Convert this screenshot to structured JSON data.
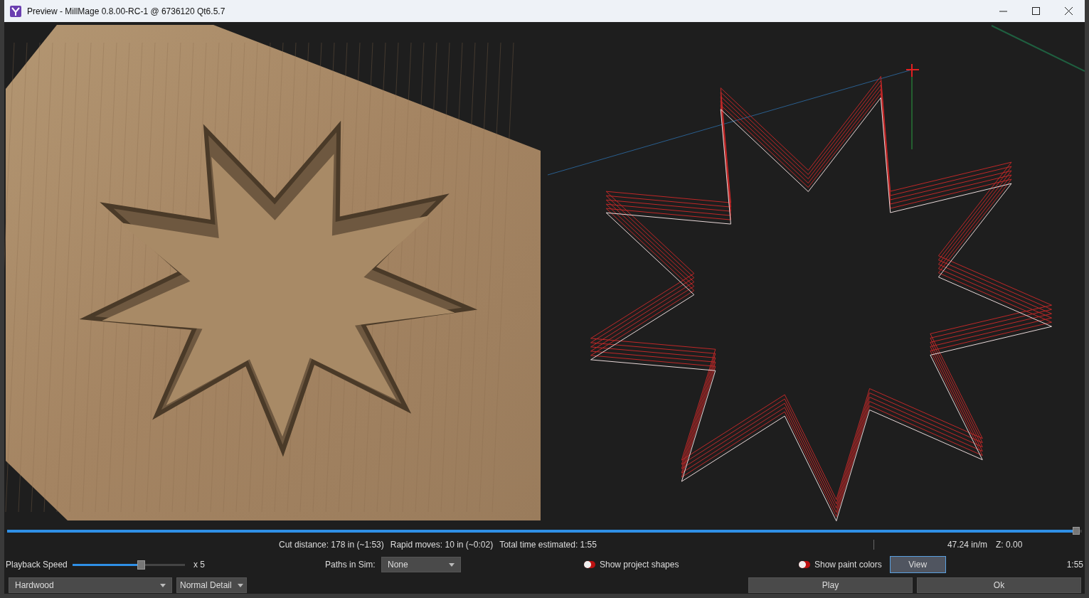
{
  "window": {
    "title": "Preview - MillMage 0.8.00-RC-1 @ 6736120 Qt6.5.7"
  },
  "timeline": {
    "level": 0.995
  },
  "stats": [
    "Cut distance: 178 in (~1:53)",
    "Rapid moves: 10 in (~0:02)",
    "Total time estimated: 1:55"
  ],
  "feed_rate": "47.24 in/m",
  "z_position": "Z: 0.00",
  "playback": {
    "label": "Playback Speed",
    "level": 0.61,
    "multiplier": "x 5"
  },
  "paths_in_sim": {
    "label": "Paths in Sim:",
    "value": "None"
  },
  "toggles": [
    {
      "label": "Show project shapes",
      "on": false
    },
    {
      "label": "Show paint colors",
      "on": false
    }
  ],
  "view_button": {
    "label": "View",
    "focused": true
  },
  "elapsed": "1:55",
  "material": "Hardwood",
  "detail": "Normal Detail",
  "buttons": [
    "Play",
    "Ok"
  ]
}
